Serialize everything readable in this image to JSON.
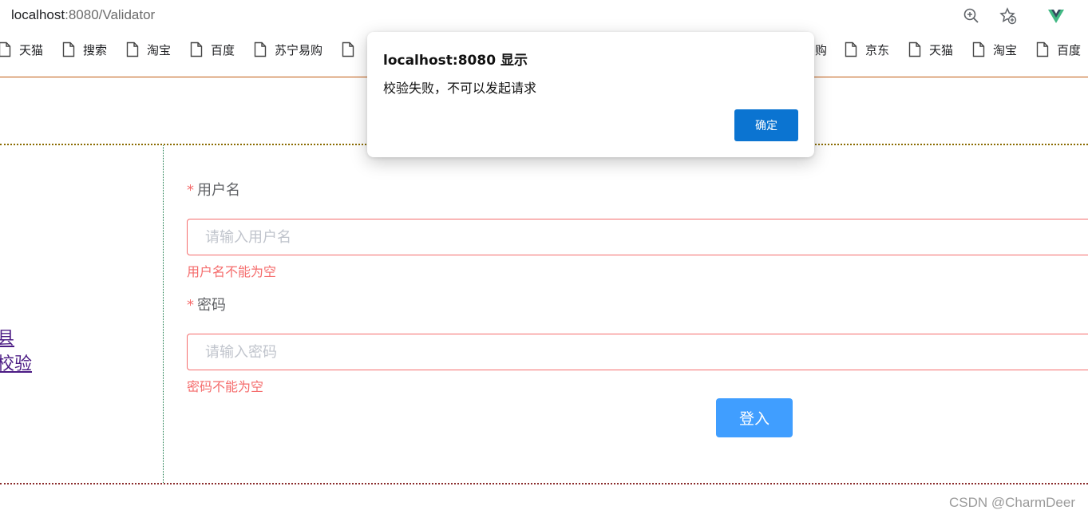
{
  "browser": {
    "url_host": "localhost",
    "url_rest": ":8080/Validator",
    "bookmarks_left": [
      "天猫",
      "搜索",
      "淘宝",
      "百度",
      "苏宁易购",
      ""
    ],
    "bookmarks_right": [
      "购",
      "京东",
      "天猫",
      "淘宝",
      "百度"
    ],
    "zoom_icon": "zoom-in-icon",
    "favorite_icon": "add-favorite-icon",
    "extension_icon": "vue-devtools-icon"
  },
  "aside": {
    "links": [
      "县",
      "校验"
    ]
  },
  "form": {
    "username": {
      "required_mark": "*",
      "label": "用户名",
      "placeholder": "请输入用户名",
      "value": "",
      "error": "用户名不能为空"
    },
    "password": {
      "required_mark": "*",
      "label": "密码",
      "placeholder": "请输入密码",
      "value": "",
      "error": "密码不能为空"
    },
    "submit_label": "登入"
  },
  "dialog": {
    "title": "localhost:8080 显示",
    "message": "校验失败，不可以发起请求",
    "ok_label": "确定"
  },
  "watermark": "CSDN @CharmDeer",
  "colors": {
    "error": "#f56c6c",
    "primary_button": "#409eff",
    "dialog_button": "#0b74d1",
    "visited_link": "#4b1b84"
  }
}
